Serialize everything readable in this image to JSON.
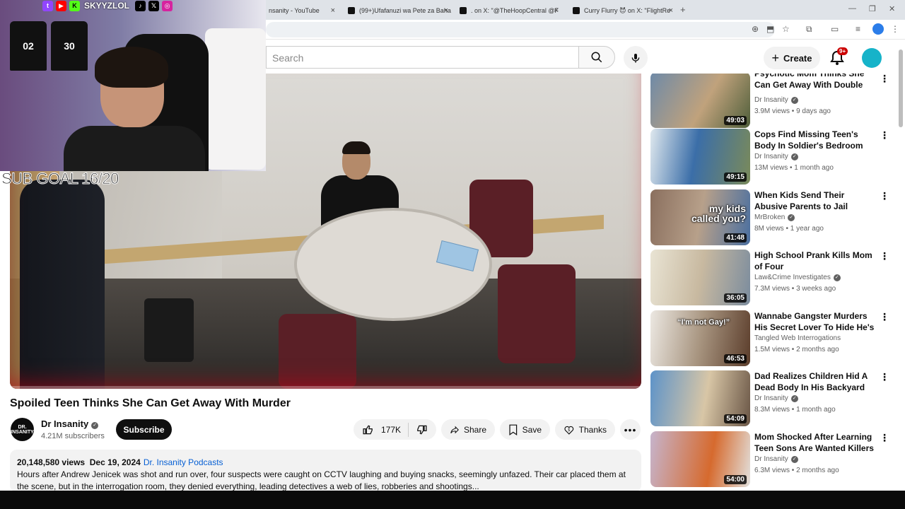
{
  "browser": {
    "tabs": [
      {
        "title": "nsanity - YouTube"
      },
      {
        "title": "(99+)Ufafanuzi wa Pete za Baha"
      },
      {
        "title": ". on X: \"@TheHoopCentral @F"
      },
      {
        "title": "Curry Flurry 😈 on X: \"FlightRe"
      }
    ]
  },
  "youtube": {
    "search_placeholder": "Search",
    "create_label": "Create",
    "notifications_badge": "9+"
  },
  "webcam": {
    "channel_handle": "SKYYZLOL",
    "sub_goal": "SUB GOAL 16/20",
    "jersey_1": "02",
    "jersey_2": "30"
  },
  "video": {
    "title": "Spoiled Teen Thinks She Can Get Away With Murder",
    "progress_fraction": 0.0,
    "channel": {
      "avatar_text": "DR.\nINSANITY",
      "name": "Dr Insanity",
      "subscribers": "4.21M subscribers"
    },
    "subscribe_label": "Subscribe",
    "likes": "177K",
    "share_label": "Share",
    "save_label": "Save",
    "thanks_label": "Thanks",
    "views": "20,148,580 views",
    "date": "Dec 19, 2024",
    "podcast_link": "Dr. Insanity Podcasts",
    "description": "Hours after Andrew Jenicek was shot and run over, four suspects were caught on CCTV laughing and buying snacks, seemingly unfazed. Their car placed them at the scene, but in the interrogation room, they denied everything, leading detectives a web of lies, robberies and shootings..."
  },
  "sidebar": {
    "items": [
      {
        "title": "Psychotic Mom Thinks She Can Get Away With Double Murder",
        "channel": "Dr Insanity",
        "verified": true,
        "stats": "3.9M views • 9 days ago",
        "duration": "49:03",
        "overlay": ""
      },
      {
        "title": "Cops Find Missing Teen's Body In Soldier's Bedroom",
        "channel": "Dr Insanity",
        "verified": true,
        "stats": "13M views • 1 month ago",
        "duration": "49:15",
        "overlay": ""
      },
      {
        "title": "When Kids Send Their Abusive Parents to Jail",
        "channel": "MrBroken",
        "verified": true,
        "stats": "8M views • 1 year ago",
        "duration": "41:48",
        "overlay": "my kids called you?"
      },
      {
        "title": "High School Prank Kills Mom of Four",
        "channel": "Law&Crime Investigates",
        "verified": true,
        "stats": "7.3M views • 3 weeks ago",
        "duration": "36:05",
        "overlay": ""
      },
      {
        "title": "Wannabe Gangster Murders His Secret Lover To Hide He's Gay",
        "channel": "Tangled Web Interrogations",
        "verified": false,
        "stats": "1.5M views • 2 months ago",
        "duration": "46:53",
        "overlay": "“I'm not Gay!”"
      },
      {
        "title": "Dad Realizes Children Hid A Dead Body In His Backyard",
        "channel": "Dr Insanity",
        "verified": true,
        "stats": "8.3M views • 1 month ago",
        "duration": "54:09",
        "overlay": ""
      },
      {
        "title": "Mom Shocked After Learning Teen Sons Are Wanted Killers",
        "channel": "Dr Insanity",
        "verified": true,
        "stats": "6.3M views • 2 months ago",
        "duration": "54:00",
        "overlay": ""
      }
    ]
  },
  "colors": {
    "accent_red": "#ff0000",
    "link_blue": "#065fd4",
    "badge_red": "#cc0000"
  }
}
